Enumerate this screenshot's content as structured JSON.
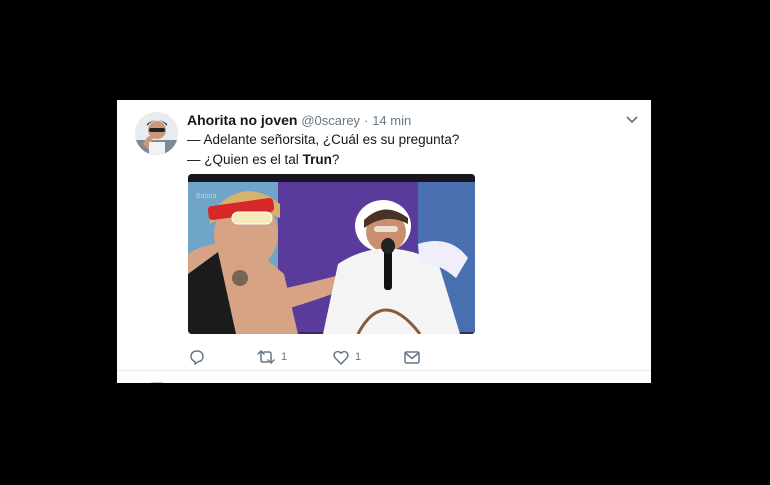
{
  "tweet": {
    "author_name": "Ahorita no joven",
    "author_handle": "@0scarey",
    "separator": "·",
    "time": "14 min",
    "line1": "— Adelante señorsita, ¿Cuál es su pregunta?",
    "line2_prefix": "— ¿Quien es el tal ",
    "line2_bold": "Trun",
    "line2_suffix": "?",
    "media_watermark": "Batura",
    "actions": {
      "reply_icon": "reply-icon",
      "retweet_icon": "retweet-icon",
      "retweet_count": "1",
      "like_icon": "heart-icon",
      "like_count": "1",
      "dm_icon": "envelope-icon"
    }
  },
  "colors": {
    "background": "#000000",
    "card": "#ffffff",
    "text": "#14171a",
    "muted": "#657786",
    "accent": "#1da1f2"
  }
}
